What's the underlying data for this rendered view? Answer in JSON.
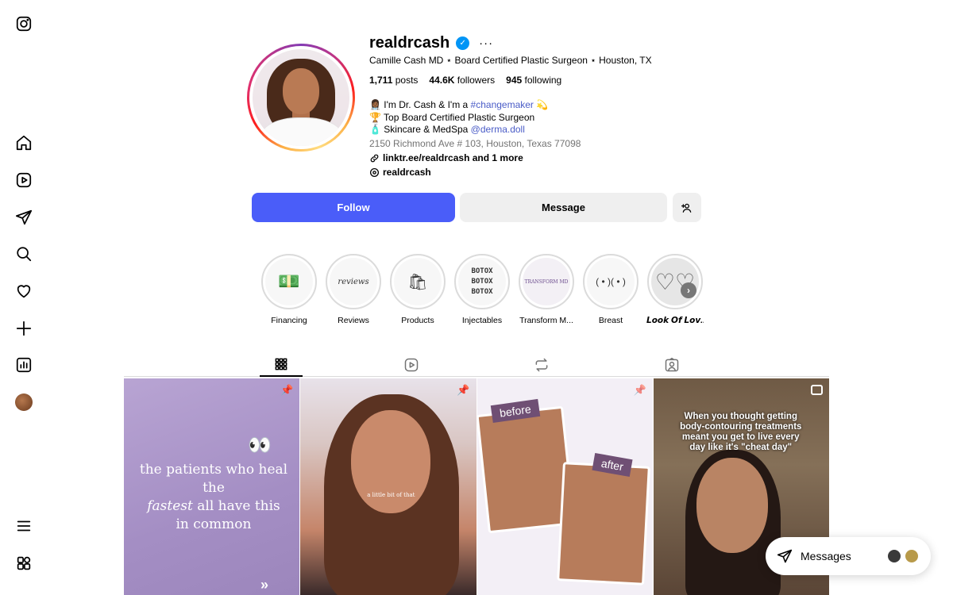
{
  "profile": {
    "username": "realdrcash",
    "fullname_line": "Camille Cash MD ⋆ Board Certified Plastic Surgeon ⋆ Houston, TX",
    "posts_count": "1,711",
    "posts_label": "posts",
    "followers_count": "44.6K",
    "followers_label": "followers",
    "following_count": "945",
    "following_label": "following",
    "bio_line1_prefix": "👩🏾‍⚕️ I'm Dr. Cash & I'm a ",
    "bio_line1_tag": "#changemaker",
    "bio_line1_suffix": " 💫",
    "bio_line2": "🏆 Top Board Certified Plastic Surgeon",
    "bio_line3_prefix": "🧴 Skincare & MedSpa ",
    "bio_line3_tag": "@derma.doll",
    "address": "2150 Richmond Ave # 103, Houston, Texas 77098",
    "link": "linktr.ee/realdrcash and 1 more",
    "threads": "realdrcash"
  },
  "actions": {
    "follow": "Follow",
    "message": "Message"
  },
  "highlights": [
    {
      "label": "Financing",
      "thumb": "💵"
    },
    {
      "label": "Reviews",
      "thumb": "reviews"
    },
    {
      "label": "Products",
      "thumb": "🛍"
    },
    {
      "label": "Injectables",
      "thumb": "BOTOX BOTOX BOTOX"
    },
    {
      "label": "Transform M...",
      "thumb": "TRANSFORM MD"
    },
    {
      "label": "Breast",
      "thumb": "( • )( • )"
    },
    {
      "label": "𝙇𝙤𝙤𝙠 𝙊𝙛 𝙇𝙤𝙫...",
      "thumb": "♡♡"
    }
  ],
  "posts": {
    "p1_text_a": "the patients who heal the",
    "p1_text_b": "fastest",
    "p1_text_c": " all have this",
    "p1_text_d": "in common",
    "p2_caption": "a little bit of that",
    "p3_before": "before",
    "p3_after": "after",
    "p4_caption": "When you thought getting body-contouring treatments meant you get to live every day like it's \"cheat day\""
  },
  "messages": {
    "label": "Messages"
  },
  "colors": {
    "follow_button": "#4a5df9",
    "link": "#4a5cc7",
    "verified": "#0095f6"
  }
}
